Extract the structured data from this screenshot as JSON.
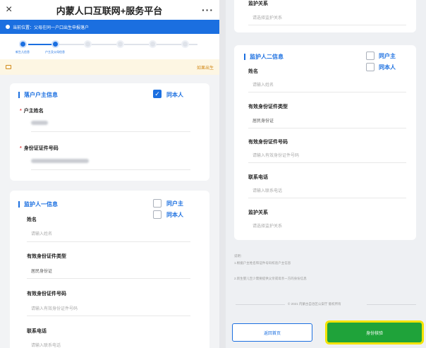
{
  "header": {
    "title": "内蒙人口互联网+服务平台",
    "close_icon": "×",
    "more_icon": "···"
  },
  "location": {
    "text": "当前位置：父母在同一户口出生申报落户"
  },
  "steps": [
    {
      "label": "新生儿信息"
    },
    {
      "label": "户主及父母信息"
    },
    {
      "label": ""
    },
    {
      "label": ""
    },
    {
      "label": ""
    },
    {
      "label": ""
    }
  ],
  "notice": {
    "right": "如果出生"
  },
  "householder": {
    "title": "落户户主信息",
    "same_label": "同本人",
    "name_label": "户主姓名",
    "id_label": "身份证证件号码"
  },
  "guardian1": {
    "title": "监护人一信息",
    "opt_householder": "同户主",
    "opt_self": "同本人",
    "name_label": "姓名",
    "name_ph": "请输入姓名",
    "idtype_label": "有效身份证件类型",
    "idtype_value": "居民身份证",
    "idno_label": "有效身份证件号码",
    "idno_ph": "请输入有效身份证件号码",
    "phone_label": "联系电话",
    "phone_ph": "请输入联系电话"
  },
  "right_top": {
    "relation_label": "监护关系",
    "relation_ph": "请选择监护关系"
  },
  "guardian2": {
    "title": "监护人二信息",
    "opt_householder": "同户主",
    "opt_self": "同本人",
    "name_label": "姓名",
    "name_ph": "请输入姓名",
    "idtype_label": "有效身份证件类型",
    "idtype_value": "居民身份证",
    "idno_label": "有效身份证件号码",
    "idno_ph": "请输入有效身份证件号码",
    "phone_label": "联系电话",
    "phone_ph": "请输入联系电话",
    "relation_label": "监护关系",
    "relation_ph": "请选择监护关系"
  },
  "notes": {
    "title": "说明：",
    "l1": "1.根据户主姓名和证件号码校验户主信息",
    "l2": "2.新生婴儿至少需要提供父亲或母亲一方的身份信息"
  },
  "footer": {
    "copyright": "© 2021 内蒙古自治区公安厅 版权所有",
    "back_btn": "返回首页",
    "verify_btn": "身份核验"
  },
  "colors": {
    "primary": "#1b6fe0",
    "verify": "#1fa33a",
    "highlight": "#f3e300"
  }
}
